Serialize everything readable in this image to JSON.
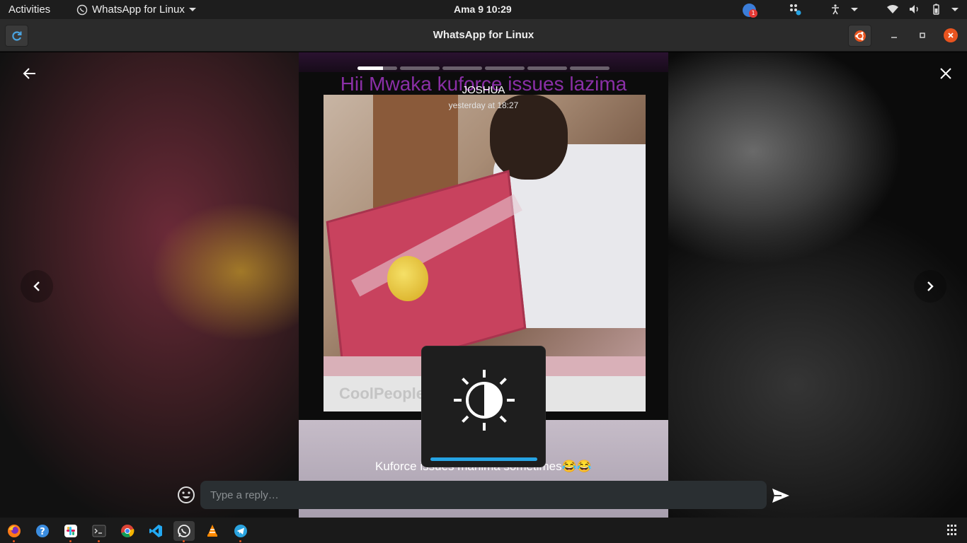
{
  "topbar": {
    "activities": "Activities",
    "app_menu": "WhatsApp for Linux",
    "clock": "Ama 9  10:29",
    "notification_count": "1"
  },
  "window": {
    "title": "WhatsApp for Linux"
  },
  "status": {
    "banner_text": "Hii Mwaka kuforce issues lazima",
    "author": "JOSHUA",
    "timestamp": "yesterday at 18:27",
    "caption": "Kuforce issues mahima sometimes😂😂",
    "watermark": "CoolPeopleSh",
    "progress": [
      0.65,
      0,
      0,
      0,
      0,
      0
    ]
  },
  "reply": {
    "placeholder": "Type a reply…"
  },
  "osd": {
    "brightness_level": 1.0
  },
  "dock": {
    "items": [
      "firefox-icon",
      "help-icon",
      "slack-icon",
      "terminal-icon",
      "chrome-icon",
      "vscode-icon",
      "whatsapp-icon",
      "vlc-icon",
      "telegram-icon"
    ]
  },
  "colors": {
    "accent_orange": "#e9541f",
    "osd_blue": "#26a3e3",
    "banner_purple": "#8a2fa6"
  }
}
